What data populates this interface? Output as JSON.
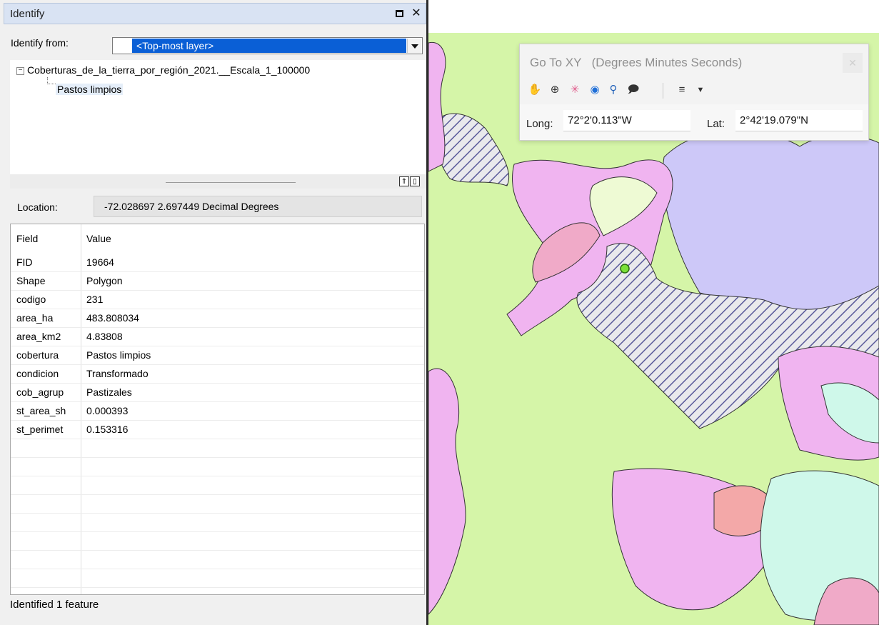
{
  "identify": {
    "title": "Identify",
    "from_label": "Identify from:",
    "from_value": "<Top-most layer>",
    "tree": {
      "layer": "Coberturas_de_la_tierra_por_región_2021.__Escala_1_100000",
      "feature": "Pastos limpios",
      "expander": "−"
    },
    "location_label": "Location:",
    "location_value": "-72.028697  2.697449 Decimal Degrees",
    "table": {
      "headers": [
        "Field",
        "Value"
      ],
      "rows": [
        {
          "field": "FID",
          "value": "19664"
        },
        {
          "field": "Shape",
          "value": "Polygon"
        },
        {
          "field": "codigo",
          "value": "231"
        },
        {
          "field": "area_ha",
          "value": "483.808034"
        },
        {
          "field": "area_km2",
          "value": "4.83808"
        },
        {
          "field": "cobertura",
          "value": "Pastos limpios"
        },
        {
          "field": "condicion",
          "value": "Transformado"
        },
        {
          "field": "cob_agrup",
          "value": "Pastizales"
        },
        {
          "field": "st_area_sh",
          "value": "0.000393"
        },
        {
          "field": "st_perimet",
          "value": "0.153316"
        }
      ]
    },
    "status": "Identified 1 feature",
    "icons": {
      "restore": "restore-window-icon",
      "close": "close-icon"
    }
  },
  "gotoxy": {
    "title": "Go To XY",
    "subtitle": "(Degrees Minutes Seconds)",
    "long_label": "Long:",
    "long_value": "72°2'0.113\"W",
    "lat_label": "Lat:",
    "lat_value": "2°42'19.079\"N",
    "tools": [
      "pan-icon",
      "zoom-icon",
      "flash-icon",
      "add-point-icon",
      "add-labeled-point-icon",
      "add-callout-icon",
      "menu-icon",
      "dropdown-icon"
    ]
  },
  "map": {
    "colors": {
      "pasture_green": "#d5f5a8",
      "lilac": "#f0b4f0",
      "lavender": "#cdc8f8",
      "pink": "#f0aac8",
      "pale_yellow": "#eefad4",
      "mint": "#cff8ea",
      "salmon": "#f3a8a8",
      "hatch": "#5a5a9a"
    }
  }
}
